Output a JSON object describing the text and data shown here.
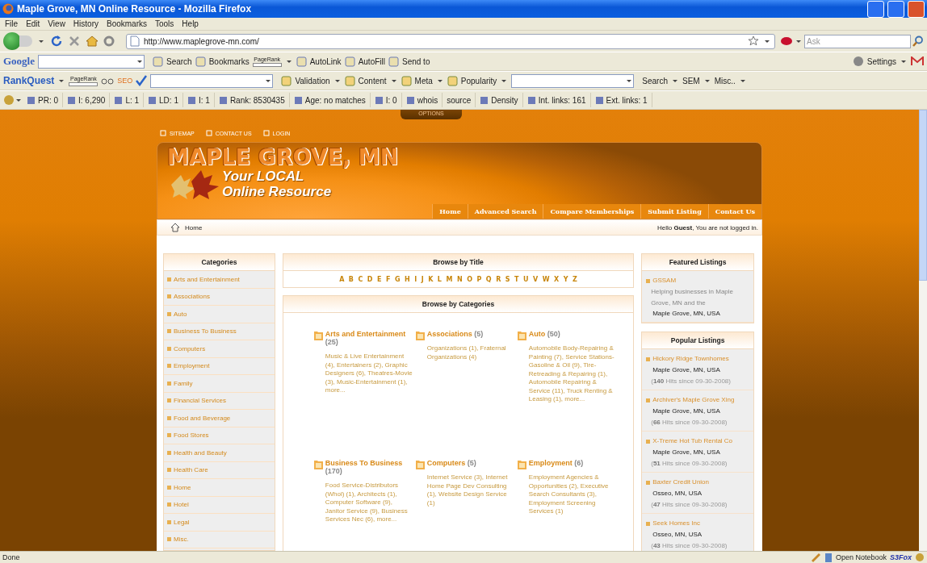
{
  "window": {
    "title": "Maple Grove, MN Online Resource - Mozilla Firefox"
  },
  "menu_bar": [
    "File",
    "Edit",
    "View",
    "History",
    "Bookmarks",
    "Tools",
    "Help"
  ],
  "navigation": {
    "url": "http://www.maplegrove-mn.com/",
    "search_placeholder": "Ask"
  },
  "google_toolbar": {
    "brand": "Google",
    "buttons": [
      {
        "kind": "icon",
        "label": "Search"
      },
      {
        "kind": "icon",
        "label": "Bookmarks"
      },
      {
        "kind": "pagerank",
        "label": "PageRank"
      },
      {
        "kind": "icon",
        "label": "AutoLink"
      },
      {
        "kind": "icon",
        "label": "AutoFill"
      },
      {
        "kind": "icon",
        "label": "Send to"
      }
    ],
    "settings": "Settings"
  },
  "rankquest_toolbar": {
    "brand": "RankQuest",
    "pagerank": "PageRank",
    "seo": "SEO",
    "buttons": [
      "Validation",
      "Content",
      "Meta",
      "Popularity"
    ],
    "buttons_2": [
      "Search",
      "SEM",
      "Misc.."
    ]
  },
  "stats_bar": [
    {
      "label": "PR: 0",
      "icon": true
    },
    {
      "label": "I: 6,290",
      "icon": true
    },
    {
      "label": "L: 1",
      "icon": true
    },
    {
      "label": "LD: 1",
      "icon": true
    },
    {
      "label": "I: 1",
      "icon": true
    },
    {
      "label": "Rank: 8530435",
      "icon": true
    },
    {
      "label": "Age: no matches",
      "icon": true
    },
    {
      "label": "I: 0",
      "icon": true
    },
    {
      "label": "whois",
      "icon": true
    },
    {
      "label": "source",
      "icon": false
    },
    {
      "label": "Density",
      "icon": true
    },
    {
      "label": "Int. links: 161",
      "icon": true
    },
    {
      "label": "Ext. links: 1",
      "icon": true
    }
  ],
  "page": {
    "options_tab": "OPTIONS",
    "top_links": [
      "SITEMAP",
      "CONTACT US",
      "LOGIN"
    ],
    "logo": {
      "title": "MAPLE GROVE, MN",
      "tagline_1": "Your LOCAL",
      "tagline_2": "Online Resource"
    },
    "menu": [
      "Home",
      "Advanced Search",
      "Compare Memberships",
      "Submit Listing",
      "Contact Us"
    ],
    "breadcrumb": "Home",
    "greeting": "Hello **Guest**, You are not logged in.",
    "categories": {
      "title": "Categories",
      "items": [
        "Arts and Entertainment",
        "Associations",
        "Auto",
        "Business To Business",
        "Computers",
        "Employment",
        "Family",
        "Financial Services",
        "Food and Beverage",
        "Food Stores",
        "Health and Beauty",
        "Health Care",
        "Home",
        "Hotel",
        "Legal",
        "Misc."
      ]
    },
    "browse_by_title": {
      "title": "Browse by Title",
      "letters": [
        "A",
        "B",
        "C",
        "D",
        "E",
        "F",
        "G",
        "H",
        "I",
        "J",
        "K",
        "L",
        "M",
        "N",
        "O",
        "P",
        "Q",
        "R",
        "S",
        "T",
        "U",
        "V",
        "W",
        "X",
        "Y",
        "Z"
      ]
    },
    "browse_by_categories": {
      "title": "Browse by Categories",
      "groups": [
        {
          "name": "Arts and Entertainment",
          "count": "(25)",
          "subcategories": "Music & Live Entertainment (4), Entertainers (2), Graphic Designers (6), Theatres-Movie (3), Music-Entertainment (1), more..."
        },
        {
          "name": "Associations",
          "count": "(5)",
          "subcategories": "Organizations (1), Fraternal Organizations (4)"
        },
        {
          "name": "Auto",
          "count": "(50)",
          "subcategories": "Automobile Body-Repairing & Painting (7), Service Stations-Gasoline & Oil (9), Tire-Retreading & Repairing (1), Automobile Repairing & Service (11), Truck Renting & Leasing (1), more..."
        },
        {
          "name": "Business To Business",
          "count": "(170)",
          "subcategories": "Food Service-Distributors (Whol) (1), Architects (1), Computer Software (9), Janitor Service (9), Business Services Nec (6), more..."
        },
        {
          "name": "Computers",
          "count": "(5)",
          "subcategories": "Internet Service (3), Internet Home Page Dev Consulting (1), Website Design Service (1)"
        },
        {
          "name": "Employment",
          "count": "(6)",
          "subcategories": "Employment Agencies & Opportunities (2), Executive Search Consultants (3), Employment Screening Services (1)"
        }
      ]
    },
    "featured_listings": {
      "title": "Featured Listings",
      "items": [
        {
          "name": "GSSAM",
          "description": "Helping businesses in Maple Grove, MN and the",
          "location": "Maple Grove, MN, USA"
        }
      ]
    },
    "popular_listings": {
      "title": "Popular Listings",
      "items": [
        {
          "name": "Hickory Ridge Townhomes",
          "location": "Maple Grove, MN, USA",
          "hits": "(**140** Hits since 09-30-2008)"
        },
        {
          "name": "Archiver's Maple Grove Xing",
          "location": "Maple Grove, MN, USA",
          "hits": "(**66** Hits since 09-30-2008)"
        },
        {
          "name": "X-Treme Hot Tub Rental Co",
          "location": "Maple Grove, MN, USA",
          "hits": "(**51** Hits since 09-30-2008)"
        },
        {
          "name": "Baxter Credit Union",
          "location": "Osseo, MN, USA",
          "hits": "(**47** Hits since 09-30-2008)"
        },
        {
          "name": "Seek Homes Inc",
          "location": "Osseo, MN, USA",
          "hits": "(**43** Hits since 09-30-2008)"
        }
      ]
    }
  },
  "status_bar": {
    "text": "Done",
    "items": [
      "Open Notebook",
      "S3Fox"
    ]
  }
}
